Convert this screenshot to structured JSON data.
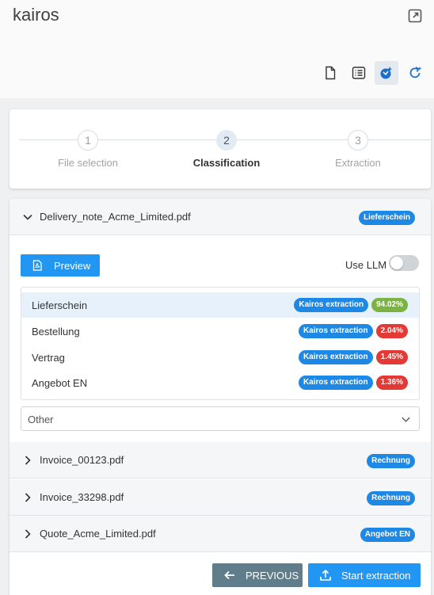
{
  "app": {
    "title": "kairos"
  },
  "toolbar": {
    "icons": [
      "document-icon",
      "list-icon",
      "classify-icon",
      "refresh-icon"
    ],
    "active": "classify-icon"
  },
  "stepper": {
    "steps": [
      {
        "number": "1",
        "label": "File selection"
      },
      {
        "number": "2",
        "label": "Classification"
      },
      {
        "number": "3",
        "label": "Extraction"
      }
    ],
    "active_step": 2
  },
  "files": [
    {
      "name": "Delivery_note_Acme_Limited.pdf",
      "badge": "Lieferschein",
      "expanded": true
    },
    {
      "name": "Invoice_00123.pdf",
      "badge": "Rechnung",
      "expanded": false
    },
    {
      "name": "Invoice_33298.pdf",
      "badge": "Rechnung",
      "expanded": false
    },
    {
      "name": "Quote_Acme_Limited.pdf",
      "badge": "Angebot EN",
      "expanded": false
    }
  ],
  "detail": {
    "preview_label": "Preview",
    "llm_label": "Use LLM",
    "use_llm": false,
    "classes": [
      {
        "name": "Lieferschein",
        "tag": "Kairos extraction",
        "score": "94.02%",
        "score_color": "#7cb342",
        "selected": true
      },
      {
        "name": "Bestellung",
        "tag": "Kairos extraction",
        "score": "2.04%",
        "score_color": "#e53935",
        "selected": false
      },
      {
        "name": "Vertrag",
        "tag": "Kairos extraction",
        "score": "1.45%",
        "score_color": "#e53935",
        "selected": false
      },
      {
        "name": "Angebot EN",
        "tag": "Kairos extraction",
        "score": "1.36%",
        "score_color": "#e53935",
        "selected": false
      }
    ],
    "other_select": "Other"
  },
  "actions": {
    "previous": "PREVIOUS",
    "start": "Start extraction"
  },
  "colors": {
    "primary": "#2196f3",
    "secondary": "#607d8b",
    "success": "#7cb342",
    "danger": "#e53935"
  }
}
